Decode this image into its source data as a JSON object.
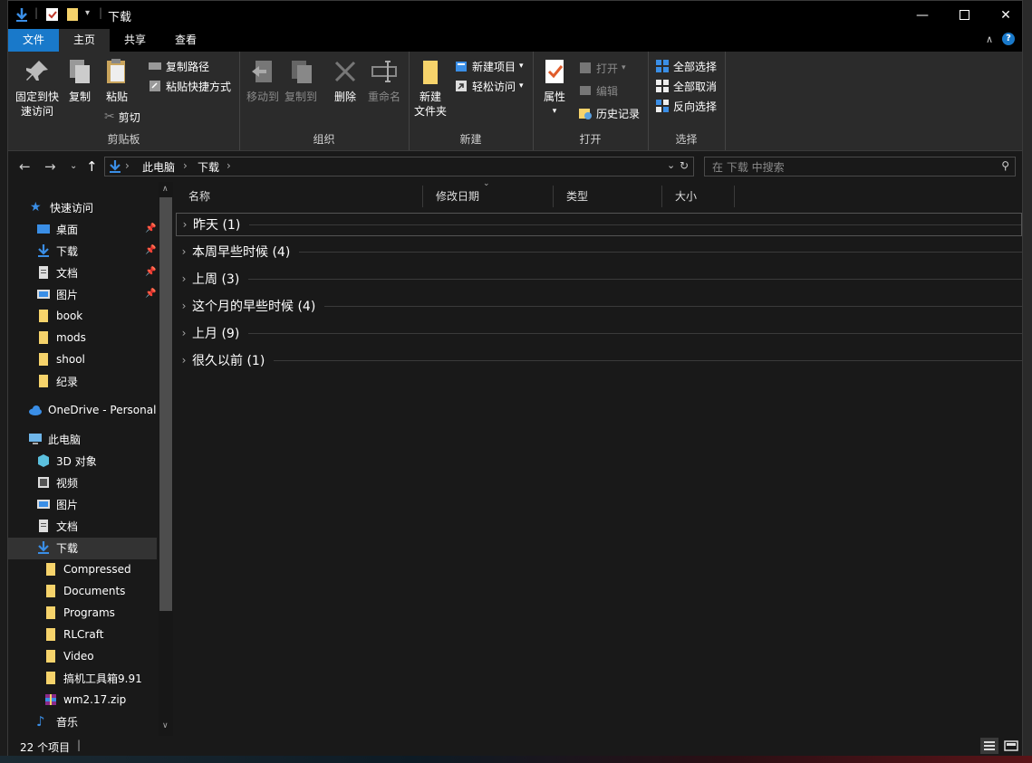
{
  "window": {
    "title": "下载"
  },
  "tabs": {
    "file": "文件",
    "home": "主页",
    "share": "共享",
    "view": "查看"
  },
  "ribbon": {
    "clipboard": {
      "label": "剪贴板",
      "pin_quick_access": "固定到快\n速访问",
      "pin_line1": "固定到快",
      "pin_line2": "速访问",
      "copy": "复制",
      "paste": "粘贴",
      "copy_path": "复制路径",
      "paste_shortcut": "粘贴快捷方式",
      "cut": "剪切"
    },
    "organize": {
      "label": "组织",
      "move_to": "移动到",
      "copy_to": "复制到",
      "delete": "删除",
      "rename": "重命名"
    },
    "new": {
      "label": "新建",
      "new_folder_1": "新建",
      "new_folder_2": "文件夹",
      "new_item": "新建项目",
      "easy_access": "轻松访问"
    },
    "open": {
      "label": "打开",
      "properties": "属性",
      "open": "打开",
      "edit": "编辑",
      "history": "历史记录"
    },
    "select": {
      "label": "选择",
      "select_all": "全部选择",
      "select_none": "全部取消",
      "invert": "反向选择"
    }
  },
  "address": {
    "crumbs": [
      "此电脑",
      "下载"
    ]
  },
  "search": {
    "placeholder": "在 下载 中搜索"
  },
  "navpane": {
    "quick_access": "快速访问",
    "quick_items": [
      "桌面",
      "下载",
      "文档",
      "图片",
      "book",
      "mods",
      "shool",
      "纪录"
    ],
    "onedrive": "OneDrive - Personal",
    "this_pc": "此电脑",
    "pc_items": [
      "3D 对象",
      "视频",
      "图片",
      "文档",
      "下载",
      "Compressed",
      "Documents",
      "Programs",
      "RLCraft",
      "Video",
      "搞机工具箱9.91",
      "wm2.17.zip",
      "音乐"
    ]
  },
  "columns": {
    "name": "名称",
    "date": "修改日期",
    "type": "类型",
    "size": "大小"
  },
  "groups": [
    "昨天 (1)",
    "本周早些时候 (4)",
    "上周 (3)",
    "这个月的早些时候 (4)",
    "上月 (9)",
    "很久以前 (1)"
  ],
  "status": {
    "count": "22 个项目"
  },
  "colors": {
    "accent": "#1979ca",
    "folder": "#f6d36b",
    "download_arrow": "#3a8ee6"
  }
}
